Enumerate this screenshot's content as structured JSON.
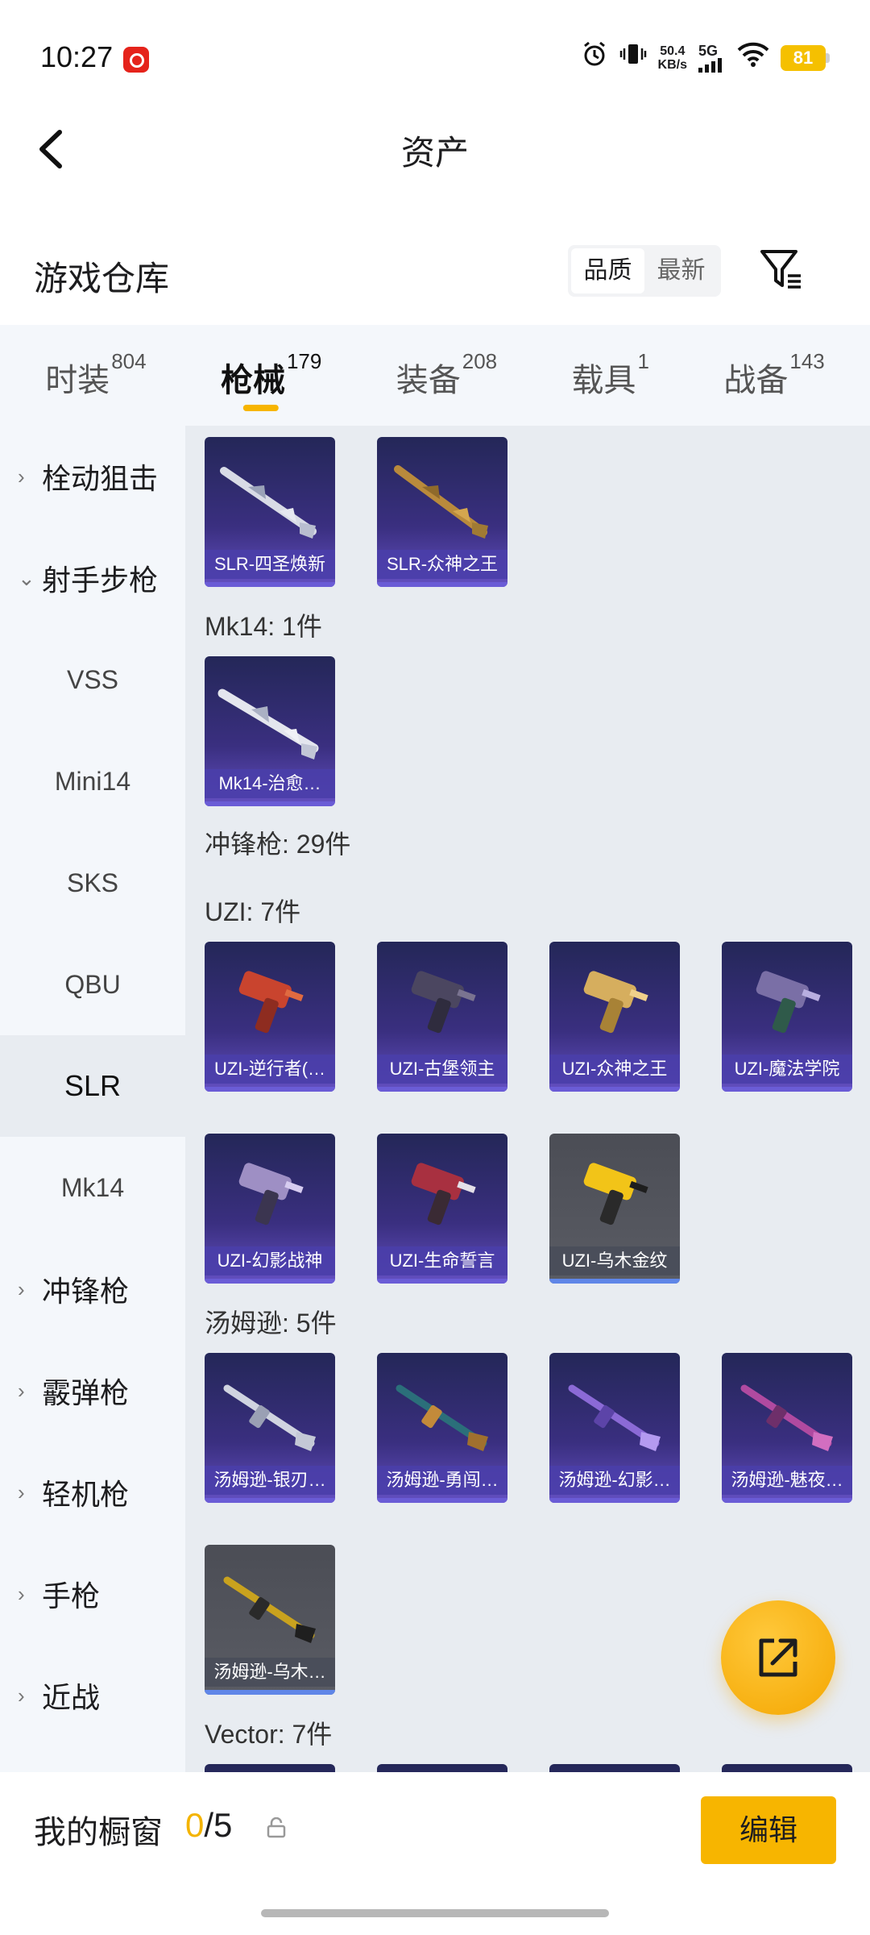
{
  "status_bar": {
    "time": "10:27",
    "speed_value": "50.4",
    "speed_unit": "KB/s",
    "network": "5G",
    "battery": "81"
  },
  "header": {
    "title": "资产"
  },
  "section": {
    "title": "游戏仓库",
    "sort_options": [
      "品质",
      "最新"
    ],
    "active_sort": "品质"
  },
  "tabs": [
    {
      "label": "时装",
      "count": "804"
    },
    {
      "label": "枪械",
      "count": "179",
      "active": true
    },
    {
      "label": "装备",
      "count": "208"
    },
    {
      "label": "载具",
      "count": "1"
    },
    {
      "label": "战备",
      "count": "143"
    }
  ],
  "sidebar": {
    "items": [
      {
        "label": "栓动狙击",
        "type": "category",
        "chevron": "›"
      },
      {
        "label": "射手步枪",
        "type": "category",
        "chevron": "⌄",
        "expanded": true
      },
      {
        "label": "VSS",
        "type": "sub"
      },
      {
        "label": "Mini14",
        "type": "sub"
      },
      {
        "label": "SKS",
        "type": "sub"
      },
      {
        "label": "QBU",
        "type": "sub"
      },
      {
        "label": "SLR",
        "type": "sub",
        "selected": true
      },
      {
        "label": "Mk14",
        "type": "sub"
      },
      {
        "label": "冲锋枪",
        "type": "category",
        "chevron": "›"
      },
      {
        "label": "霰弹枪",
        "type": "category",
        "chevron": "›"
      },
      {
        "label": "轻机枪",
        "type": "category",
        "chevron": "›"
      },
      {
        "label": "手枪",
        "type": "category",
        "chevron": "›"
      },
      {
        "label": "近战",
        "type": "category",
        "chevron": "›"
      }
    ]
  },
  "content": {
    "groups": {
      "mk14": "Mk14: 1件",
      "smg": "冲锋枪: 29件",
      "uzi": "UZI: 7件",
      "thompson": "汤姆逊: 5件",
      "vector": "Vector: 7件"
    },
    "cards": {
      "slr": [
        "SLR-四圣焕新",
        "SLR-众神之王"
      ],
      "mk14": [
        "Mk14-治愈…"
      ],
      "uzi": [
        "UZI-逆行者(…",
        "UZI-古堡领主",
        "UZI-众神之王",
        "UZI-魔法学院",
        "UZI-幻影战神",
        "UZI-生命誓言",
        "UZI-乌木金纹"
      ],
      "thompson": [
        "汤姆逊-银刃…",
        "汤姆逊-勇闯…",
        "汤姆逊-幻影…",
        "汤姆逊-魅夜…",
        "汤姆逊-乌木…"
      ]
    }
  },
  "bottom": {
    "label": "我的橱窗",
    "current": "0",
    "total": "/5",
    "edit_label": "编辑"
  },
  "colors": {
    "accent": "#f7b500",
    "card_purple": "#3a2f80",
    "card_gray": "#555860"
  }
}
